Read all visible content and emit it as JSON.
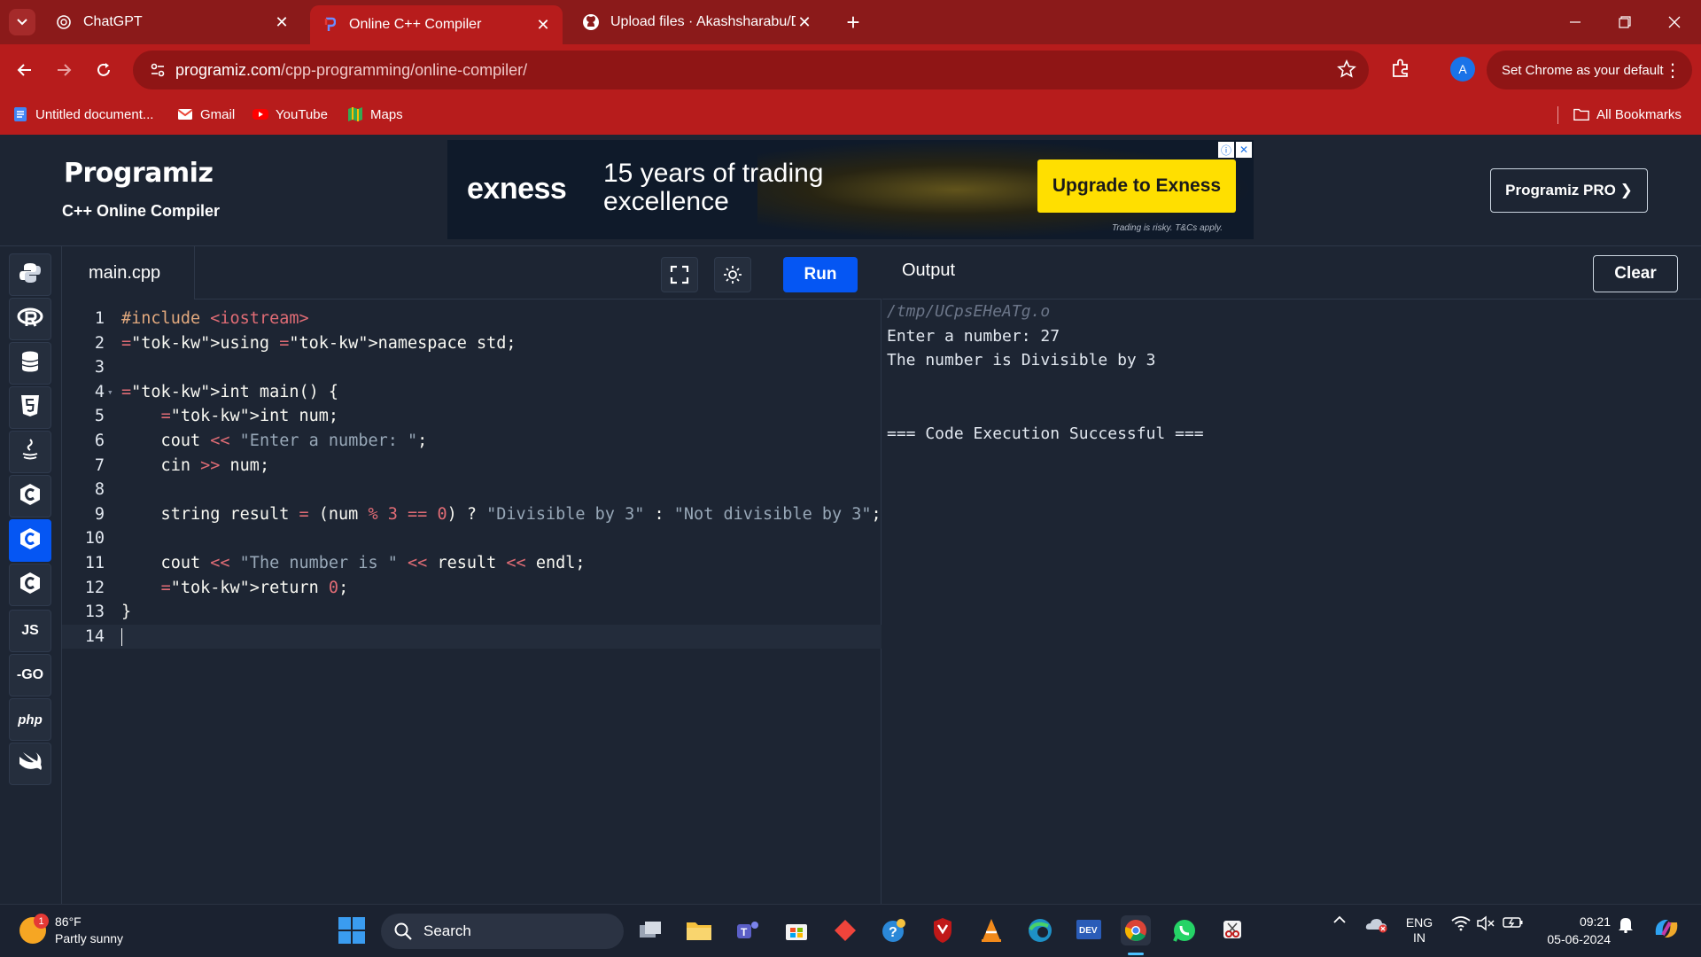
{
  "browser": {
    "tabs": [
      {
        "title": "ChatGPT",
        "icon": "chatgpt-icon",
        "active": false
      },
      {
        "title": "Online C++ Compiler",
        "icon": "programiz-icon",
        "active": true
      },
      {
        "title": "Upload files · Akashsharabu/DS",
        "icon": "github-icon",
        "active": false
      }
    ],
    "url_host": "programiz.com",
    "url_path": "/cpp-programming/online-compiler/",
    "profile_initial": "A",
    "default_button": "Set Chrome as your default",
    "bookmarks": [
      {
        "label": "Untitled document...",
        "icon": "docs-icon"
      },
      {
        "label": "Gmail",
        "icon": "gmail-icon"
      },
      {
        "label": "YouTube",
        "icon": "youtube-icon"
      },
      {
        "label": "Maps",
        "icon": "maps-icon"
      }
    ],
    "all_bookmarks": "All Bookmarks",
    "theme_color": "#b71c1c"
  },
  "site": {
    "logo": "Programiz",
    "subtitle": "C++ Online Compiler",
    "pro_button": "Programiz PRO ❯",
    "ad": {
      "brand": "exness",
      "headline": "15 years of trading excellence",
      "cta": "Upgrade to Exness",
      "disclaimer": "Trading is risky. T&Cs apply."
    }
  },
  "rail": {
    "items": [
      {
        "name": "python-icon",
        "label": "",
        "active": false
      },
      {
        "name": "r-icon",
        "label": "R",
        "active": false
      },
      {
        "name": "sql-icon",
        "label": "",
        "active": false
      },
      {
        "name": "html-icon",
        "label": "5",
        "active": false
      },
      {
        "name": "java-icon",
        "label": "",
        "active": false
      },
      {
        "name": "c-icon",
        "label": "C",
        "active": false
      },
      {
        "name": "cpp-icon",
        "label": "C",
        "active": true
      },
      {
        "name": "csharp-icon",
        "label": "C",
        "active": false
      },
      {
        "name": "javascript-icon",
        "label": "JS",
        "active": false
      },
      {
        "name": "go-icon",
        "label": "-GO",
        "active": false
      },
      {
        "name": "php-icon",
        "label": "php",
        "active": false
      },
      {
        "name": "swift-icon",
        "label": "",
        "active": false
      }
    ],
    "accent": "#0556f3"
  },
  "editor": {
    "filename": "main.cpp",
    "run_label": "Run",
    "line_numbers": [
      "1",
      "2",
      "3",
      "4",
      "5",
      "6",
      "7",
      "8",
      "9",
      "10",
      "11",
      "12",
      "13",
      "14"
    ],
    "lines": [
      "#include <iostream>",
      "using namespace std;",
      "",
      "int main() {",
      "    int num;",
      "    cout << \"Enter a number: \";",
      "    cin >> num;",
      "",
      "    string result = (num % 3 == 0) ? \"Divisible by 3\" : \"Not divisible by 3\";",
      "",
      "    cout << \"The number is \" << result << endl;",
      "    return 0;",
      "}",
      ""
    ]
  },
  "output": {
    "title": "Output",
    "clear_label": "Clear",
    "lines": [
      "/tmp/UCpsEHeATg.o",
      "Enter a number: 27",
      "The number is Divisible by 3",
      "",
      "",
      "=== Code Execution Successful ==="
    ]
  },
  "taskbar": {
    "weather_temp": "86°F",
    "weather_desc": "Partly sunny",
    "weather_badge": "1",
    "search_placeholder": "Search",
    "lang_top": "ENG",
    "lang_bottom": "IN",
    "time": "09:21",
    "date": "05-06-2024"
  }
}
